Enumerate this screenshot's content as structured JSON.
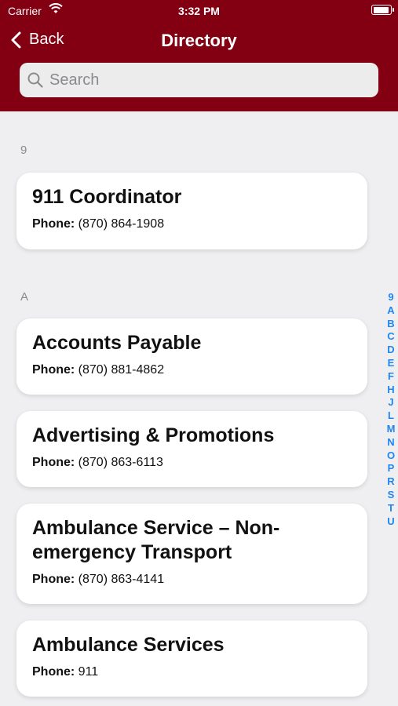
{
  "status_bar": {
    "carrier": "Carrier",
    "time": "3:32 PM"
  },
  "nav": {
    "back_label": "Back",
    "title": "Directory"
  },
  "search": {
    "placeholder": "Search"
  },
  "sections": [
    {
      "label": "9",
      "entries": [
        {
          "name": "911 Coordinator",
          "phone_label": "Phone:",
          "phone": "(870) 864-1908"
        }
      ]
    },
    {
      "label": "A",
      "entries": [
        {
          "name": "Accounts Payable",
          "phone_label": "Phone:",
          "phone": "(870) 881-4862"
        },
        {
          "name": "Advertising & Promotions",
          "phone_label": "Phone:",
          "phone": "(870) 863-6113"
        },
        {
          "name": "Ambulance Service – Non-emergency Transport",
          "phone_label": "Phone:",
          "phone": "(870) 863-4141"
        },
        {
          "name": "Ambulance Services",
          "phone_label": "Phone:",
          "phone": "911"
        }
      ]
    }
  ],
  "index_letters": [
    "9",
    "A",
    "B",
    "C",
    "D",
    "E",
    "F",
    "H",
    "J",
    "L",
    "M",
    "N",
    "O",
    "P",
    "R",
    "S",
    "T",
    "U"
  ],
  "colors": {
    "header": "#820011",
    "index": "#1e86f2",
    "background": "#efeff1"
  }
}
